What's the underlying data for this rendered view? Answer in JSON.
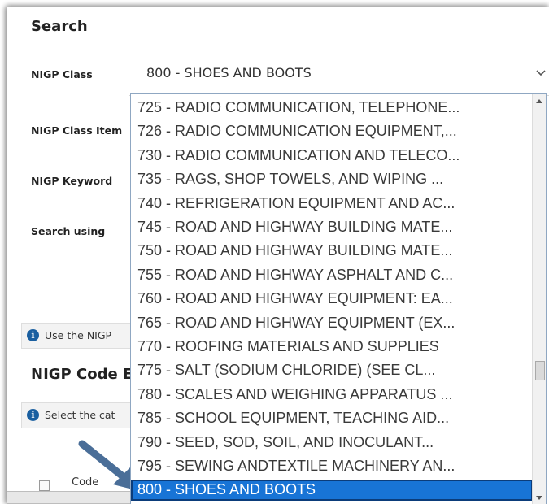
{
  "search": {
    "title": "Search",
    "labels": {
      "nigp_class": "NIGP Class",
      "nigp_class_item": "NIGP Class Item",
      "nigp_keyword": "NIGP Keyword",
      "search_using": "Search using"
    },
    "nigp_class_value": "800 - SHOES AND BOOTS",
    "icons": {
      "select_chevron": "chevron-down-icon"
    }
  },
  "info": {
    "use_nigp": "Use the NIGP",
    "select_cat": "Select the cat",
    "icon": "info-icon"
  },
  "section": {
    "title": "NIGP Code E"
  },
  "table": {
    "code_header": "Code"
  },
  "dropdown": {
    "items": [
      "725 - RADIO COMMUNICATION, TELEPHONE...",
      "726 - RADIO COMMUNICATION EQUIPMENT,...",
      "730 - RADIO COMMUNICATION AND TELECO...",
      "735 - RAGS, SHOP TOWELS, AND WIPING ...",
      "740 - REFRIGERATION EQUIPMENT AND AC...",
      "745 - ROAD AND HIGHWAY BUILDING MATE...",
      "750 - ROAD AND HIGHWAY BUILDING MATE...",
      "755 - ROAD AND HIGHWAY ASPHALT AND C...",
      "760 - ROAD AND HIGHWAY EQUIPMENT: EA...",
      "765 - ROAD AND HIGHWAY EQUIPMENT (EX...",
      "770 - ROOFING MATERIALS AND SUPPLIES",
      "775 - SALT (SODIUM CHLORIDE) (SEE CL...",
      "780 - SCALES AND WEIGHING APPARATUS ...",
      "785 - SCHOOL EQUIPMENT, TEACHING AID...",
      "790 - SEED, SOD, SOIL, AND INOCULANT...",
      "795 - SEWING ANDTEXTILE MACHINERY AN...",
      "800 - SHOES AND BOOTS"
    ],
    "selected": "800 - SHOES AND BOOTS"
  },
  "colors": {
    "selected_bg": "#1874d6",
    "arrow": "#4a6e98",
    "info_icon": "#1a5fa0"
  }
}
